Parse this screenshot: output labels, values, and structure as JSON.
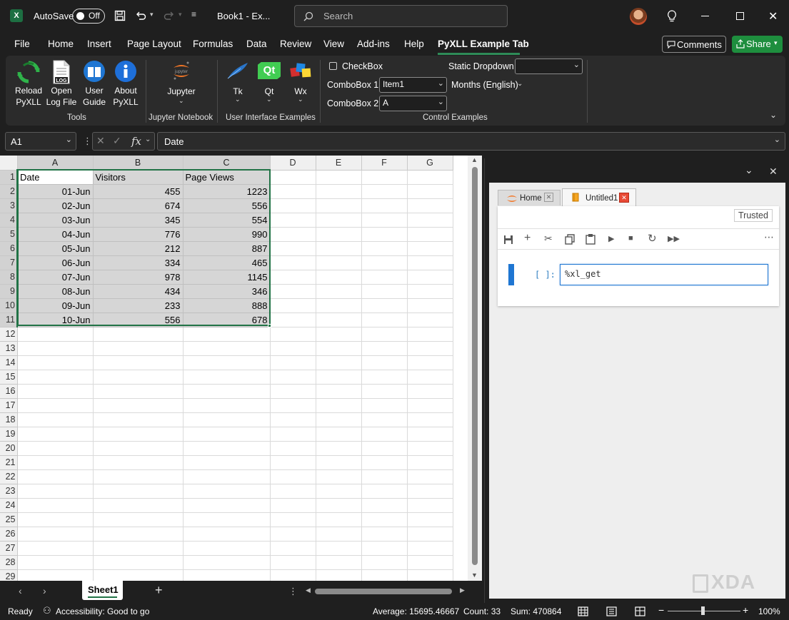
{
  "titlebar": {
    "autosave_label": "AutoSave",
    "autosave_state": "Off",
    "doc_title": "Book1  -  Ex...",
    "search_placeholder": "Search"
  },
  "menu": {
    "tabs": [
      "File",
      "Home",
      "Insert",
      "Page Layout",
      "Formulas",
      "Data",
      "Review",
      "View",
      "Add-ins",
      "Help",
      "PyXLL Example Tab"
    ],
    "active": "PyXLL Example Tab",
    "comments": "Comments",
    "share": "Share"
  },
  "ribbon": {
    "tools": {
      "reload": [
        "Reload",
        "PyXLL"
      ],
      "open_log": [
        "Open",
        "Log File"
      ],
      "user_guide": [
        "User",
        "Guide"
      ],
      "about": [
        "About",
        "PyXLL"
      ],
      "group": "Tools"
    },
    "jupyter": {
      "label": "Jupyter",
      "group": "Jupyter Notebook"
    },
    "ui_examples": {
      "tk": "Tk",
      "qt": "Qt",
      "wx": "Wx",
      "group": "User Interface Examples",
      "qt_logo": "Qt"
    },
    "controls": {
      "checkbox": "CheckBox",
      "static_dropdown": "Static Dropdown",
      "static_dropdown_value": "",
      "combobox1_label": "ComboBox 1",
      "combobox1_value": "Item1",
      "combobox2_label": "ComboBox 2",
      "combobox2_value": "A",
      "months": "Months (English)",
      "group": "Control Examples"
    }
  },
  "formula_bar": {
    "name_box": "A1",
    "fx": "fx",
    "value": "Date"
  },
  "sheet": {
    "columns": [
      "A",
      "B",
      "C",
      "D",
      "E",
      "F",
      "G"
    ],
    "rows": [
      [
        "Date",
        "Visitors",
        "Page Views"
      ],
      [
        "01-Jun",
        "455",
        "1223"
      ],
      [
        "02-Jun",
        "674",
        "556"
      ],
      [
        "03-Jun",
        "345",
        "554"
      ],
      [
        "04-Jun",
        "776",
        "990"
      ],
      [
        "05-Jun",
        "212",
        "887"
      ],
      [
        "06-Jun",
        "334",
        "465"
      ],
      [
        "07-Jun",
        "978",
        "1145"
      ],
      [
        "08-Jun",
        "434",
        "346"
      ],
      [
        "09-Jun",
        "233",
        "888"
      ],
      [
        "10-Jun",
        "556",
        "678"
      ]
    ],
    "row_count": 29,
    "tab": "Sheet1"
  },
  "jupyter_pane": {
    "tabs": [
      "Home",
      "Untitled1"
    ],
    "trusted": "Trusted",
    "prompt": "[ ]:",
    "cell_code": "%xl_get"
  },
  "status": {
    "ready": "Ready",
    "accessibility": "Accessibility: Good to go",
    "average": "Average: 15695.46667",
    "count": "Count: 33",
    "sum": "Sum: 470864",
    "zoom": "100%"
  },
  "watermark": "XDA",
  "colors": {
    "excel_green": "#217346",
    "share_green": "#1e8e3e",
    "jupyter_orange": "#f37626",
    "selection": "#d6d6d6"
  }
}
